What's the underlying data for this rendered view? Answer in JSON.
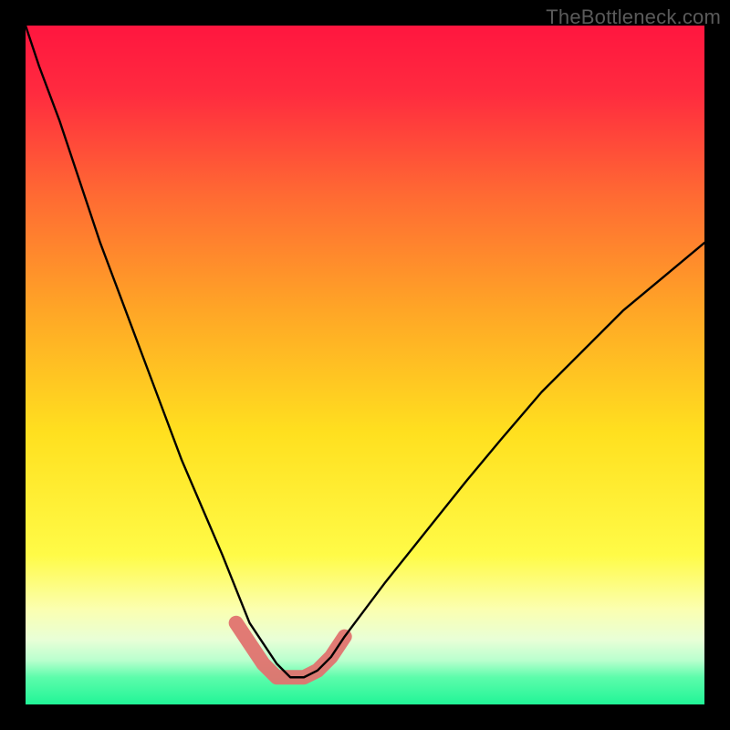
{
  "watermark": "TheBottleneck.com",
  "plot": {
    "inner_x": 28,
    "inner_y": 28,
    "inner_w": 744,
    "inner_h": 744
  },
  "chart_data": {
    "type": "line",
    "title": "",
    "xlabel": "",
    "ylabel": "",
    "xlim": [
      0,
      100
    ],
    "ylim": [
      0,
      100
    ],
    "notes": "Background is a vertical gradient red→orange→yellow→pale→green band. Bottom narrow green strip. Black V-shaped curve whose minimum sits near x≈38, y≈4. A pink/salmon marker band highlights the valley bottom between x≈33 and x≈47.",
    "gradient_stops": [
      {
        "pos": 0.0,
        "color": "#ff163f"
      },
      {
        "pos": 0.1,
        "color": "#ff2b3f"
      },
      {
        "pos": 0.25,
        "color": "#ff6a33"
      },
      {
        "pos": 0.42,
        "color": "#ffa626"
      },
      {
        "pos": 0.6,
        "color": "#ffe01f"
      },
      {
        "pos": 0.78,
        "color": "#fffb47"
      },
      {
        "pos": 0.86,
        "color": "#fbffb0"
      },
      {
        "pos": 0.905,
        "color": "#e8ffd7"
      },
      {
        "pos": 0.935,
        "color": "#b9ffce"
      },
      {
        "pos": 0.96,
        "color": "#5dfcab"
      },
      {
        "pos": 1.0,
        "color": "#21f597"
      }
    ],
    "series": [
      {
        "name": "bottleneck-curve",
        "x": [
          0,
          2,
          5,
          8,
          11,
          14,
          17,
          20,
          23,
          26,
          29,
          31,
          33,
          35,
          37,
          39,
          41,
          43,
          45,
          47,
          50,
          53,
          57,
          61,
          65,
          70,
          76,
          82,
          88,
          94,
          100
        ],
        "y": [
          100,
          94,
          86,
          77,
          68,
          60,
          52,
          44,
          36,
          29,
          22,
          17,
          12,
          9,
          6,
          4,
          4,
          5,
          7,
          10,
          14,
          18,
          23,
          28,
          33,
          39,
          46,
          52,
          58,
          63,
          68
        ]
      }
    ],
    "highlight_band": {
      "name": "valley-marker",
      "color": "#e0736f",
      "x": [
        31,
        33,
        35,
        37,
        39,
        41,
        43,
        45,
        47
      ],
      "y": [
        12,
        9,
        6,
        4,
        4,
        4,
        5,
        7,
        10
      ]
    }
  }
}
